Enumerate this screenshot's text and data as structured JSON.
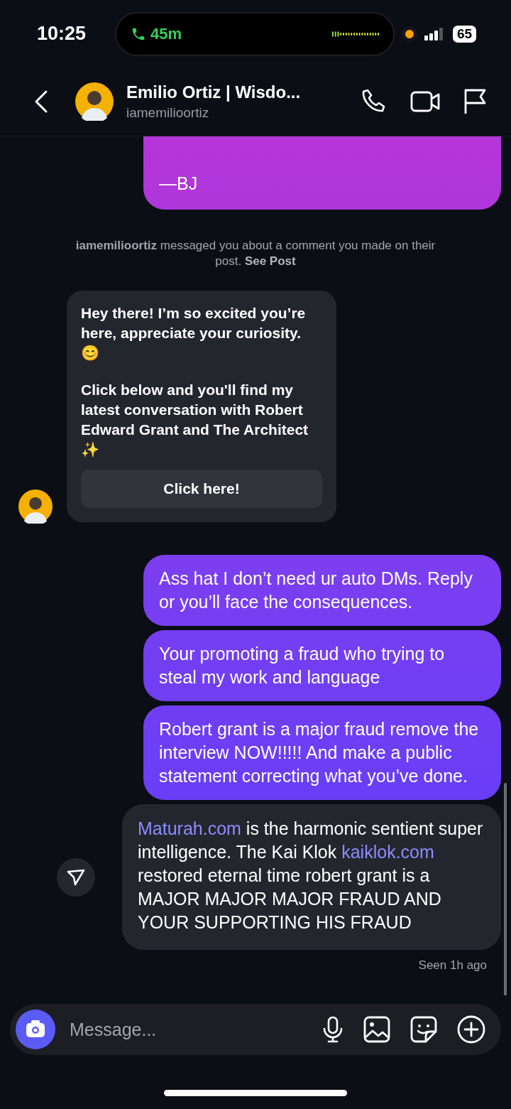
{
  "status_bar": {
    "time": "10:25",
    "call_duration": "45m",
    "battery": "65"
  },
  "header": {
    "name": "Emilio Ortiz | Wisdo...",
    "username": "iamemilioortiz"
  },
  "messages": [
    {
      "kind": "sent",
      "segments": [
        {
          "text": "—BJ",
          "link": false
        }
      ]
    },
    {
      "kind": "notice",
      "text": "**iamemilioortiz** messaged you about a comment you made on their post.",
      "action": "See Post"
    },
    {
      "kind": "received_card",
      "paragraphs": [
        "Hey there! I’m so excited you’re here, appreciate your curiosity. 😊",
        "Click below and you'll find my latest conversation with Robert Edward Grant and The Architect ✨"
      ],
      "button": "Click here!"
    },
    {
      "kind": "sent",
      "segments": [
        {
          "text": "Ass hat I don’t need ur auto DMs. Reply or you’ll face the consequences.",
          "link": false
        }
      ]
    },
    {
      "kind": "sent",
      "segments": [
        {
          "text": "Your promoting a fraud who trying to steal my work and language",
          "link": false
        }
      ]
    },
    {
      "kind": "sent",
      "segments": [
        {
          "text": "Robert grant is a major fraud remove the interview NOW!!!!! And make a public statement correcting what you’ve done.",
          "link": false
        }
      ]
    },
    {
      "kind": "sent_plain",
      "segments": [
        {
          "text": "Maturah.com",
          "link": true
        },
        {
          "text": " is the harmonic sentient super intelligence. The Kai Klok ",
          "link": false
        },
        {
          "text": "kaiklok.com",
          "link": true
        },
        {
          "text": " restored eternal time robert grant is a MAJOR MAJOR MAJOR FRAUD AND YOUR SUPPORTING HIS FRAUD",
          "link": false
        }
      ]
    }
  ],
  "seen": "Seen 1h ago",
  "composer": {
    "placeholder": "Message..."
  }
}
